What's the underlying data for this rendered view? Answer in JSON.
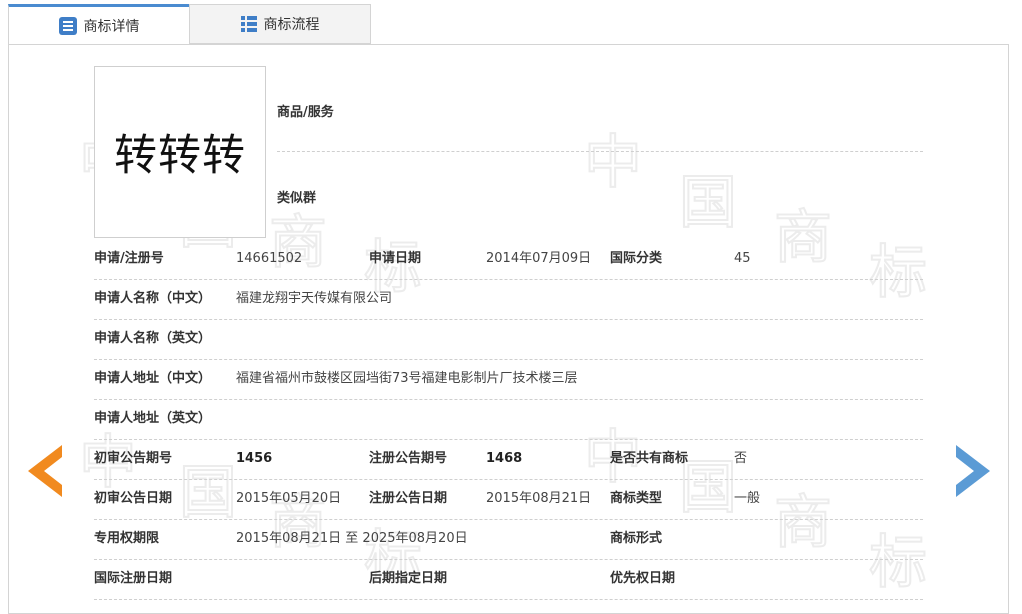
{
  "tabs": [
    {
      "label": "商标详情",
      "active": true,
      "icon": "document-list-icon"
    },
    {
      "label": "商标流程",
      "active": false,
      "icon": "list-icon"
    }
  ],
  "colors": {
    "accent": "#4a8bd0",
    "prev_arrow": "#f18a1f",
    "next_arrow": "#5b9bd5"
  },
  "watermark": {
    "text": [
      "中",
      "国",
      "商",
      "标"
    ]
  },
  "trademark": {
    "image_text": "转转转",
    "goods_services_label": "商品/服务",
    "similar_group_label": "类似群"
  },
  "rows": {
    "r1": {
      "reg_no_label": "申请/注册号",
      "reg_no": "14661502",
      "app_date_label": "申请日期",
      "app_date": "2014年07月09日",
      "intl_class_label": "国际分类",
      "intl_class": "45"
    },
    "r2": {
      "label": "申请人名称（中文）",
      "value": "福建龙翔宇天传媒有限公司"
    },
    "r3": {
      "label": "申请人名称（英文）",
      "value": ""
    },
    "r4": {
      "label": "申请人地址（中文）",
      "value": "福建省福州市鼓楼区园垱街73号福建电影制片厂技术楼三层"
    },
    "r5": {
      "label": "申请人地址（英文）",
      "value": ""
    },
    "r6": {
      "prelim_no_label": "初审公告期号",
      "prelim_no": "1456",
      "reg_pub_no_label": "注册公告期号",
      "reg_pub_no": "1468",
      "shared_label": "是否共有商标",
      "shared": "否"
    },
    "r7": {
      "prelim_date_label": "初审公告日期",
      "prelim_date": "2015年05月20日",
      "reg_pub_date_label": "注册公告日期",
      "reg_pub_date": "2015年08月21日",
      "type_label": "商标类型",
      "type": "一般"
    },
    "r8": {
      "term_label": "专用权期限",
      "term": "2015年08月21日 至 2025年08月20日",
      "form_label": "商标形式",
      "form": ""
    },
    "r9": {
      "intl_reg_date_label": "国际注册日期",
      "later_date_label": "后期指定日期",
      "priority_date_label": "优先权日期"
    }
  }
}
